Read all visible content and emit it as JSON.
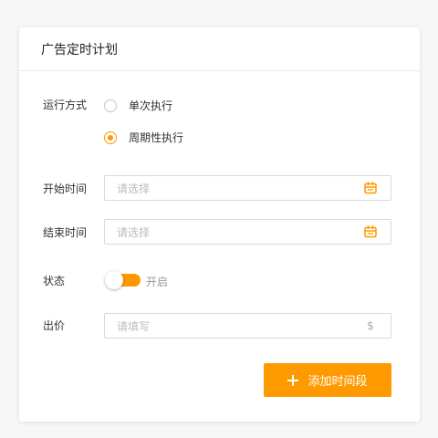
{
  "card": {
    "title": "广告定时计划"
  },
  "form": {
    "run_mode": {
      "label": "运行方式",
      "options": [
        {
          "label": "单次执行",
          "checked": false
        },
        {
          "label": "周期性执行",
          "checked": true
        }
      ]
    },
    "start_time": {
      "label": "开始时间",
      "placeholder": "请选择",
      "icon": "calendar-icon"
    },
    "end_time": {
      "label": "结束时间",
      "placeholder": "请选择",
      "icon": "calendar-icon"
    },
    "status": {
      "label": "状态",
      "switch_label": "开启",
      "on": true
    },
    "bid": {
      "label": "出价",
      "placeholder": "请填写",
      "suffix": "$"
    }
  },
  "actions": {
    "add_label": "添加时间段",
    "icon": "plus-icon"
  },
  "colors": {
    "accent": "#ff9900",
    "border": "#d9d9d9",
    "placeholder": "#bbbbbb"
  }
}
